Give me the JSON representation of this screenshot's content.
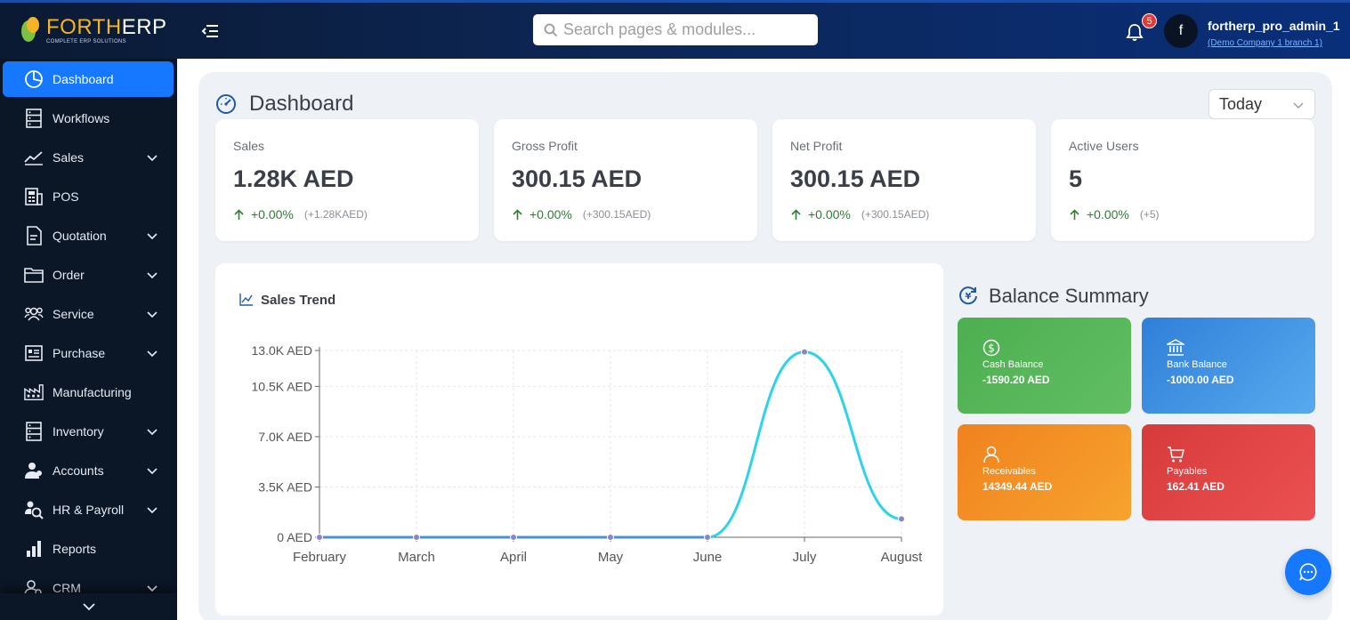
{
  "brand": {
    "name_part1": "FORTH",
    "name_part2": "ERP",
    "tagline": "COMPLETE ERP SOLUTIONS"
  },
  "header": {
    "search_placeholder": "Search pages & modules...",
    "notifications_count": "5",
    "avatar_letter": "f",
    "user_name": "fortherp_pro_admin_1",
    "company": "(Demo Company 1 branch 1)"
  },
  "sidebar": {
    "items": [
      {
        "label": "Dashboard",
        "icon": "pie-chart-icon",
        "active": true,
        "expandable": false
      },
      {
        "label": "Workflows",
        "icon": "workflow-icon",
        "expandable": false
      },
      {
        "label": "Sales",
        "icon": "line-chart-icon",
        "expandable": true
      },
      {
        "label": "POS",
        "icon": "calculator-icon",
        "expandable": false
      },
      {
        "label": "Quotation",
        "icon": "document-icon",
        "expandable": true
      },
      {
        "label": "Order",
        "icon": "folder-icon",
        "expandable": true
      },
      {
        "label": "Service",
        "icon": "team-icon",
        "expandable": true
      },
      {
        "label": "Purchase",
        "icon": "id-card-icon",
        "expandable": true
      },
      {
        "label": "Manufacturing",
        "icon": "factory-icon",
        "expandable": false
      },
      {
        "label": "Inventory",
        "icon": "inventory-icon",
        "expandable": true
      },
      {
        "label": "Accounts",
        "icon": "user-group-icon",
        "expandable": true
      },
      {
        "label": "HR & Payroll",
        "icon": "hr-icon",
        "expandable": true
      },
      {
        "label": "Reports",
        "icon": "bar-chart-icon",
        "expandable": false
      },
      {
        "label": "CRM",
        "icon": "crm-icon",
        "expandable": true
      }
    ]
  },
  "dashboard": {
    "title": "Dashboard",
    "range": "Today",
    "stats": [
      {
        "title": "Sales",
        "value": "1.28K AED",
        "delta": "+0.00%",
        "note": "(+1.28KAED)"
      },
      {
        "title": "Gross Profit",
        "value": "300.15 AED",
        "delta": "+0.00%",
        "note": "(+300.15AED)"
      },
      {
        "title": "Net Profit",
        "value": "300.15 AED",
        "delta": "+0.00%",
        "note": "(+300.15AED)"
      },
      {
        "title": "Active Users",
        "value": "5",
        "delta": "+0.00%",
        "note": "(+5)"
      }
    ],
    "balance_title": "Balance Summary",
    "balances": [
      {
        "title": "Cash Balance",
        "value": "-1590.20 AED",
        "icon": "dollar-icon",
        "color": "#4caf50"
      },
      {
        "title": "Bank Balance",
        "value": "-1000.00 AED",
        "icon": "bank-icon",
        "color": "#2f7fd9"
      },
      {
        "title": "Receivables",
        "value": "14349.44 AED",
        "icon": "user-icon",
        "color": "#f0821e"
      },
      {
        "title": "Payables",
        "value": "162.41 AED",
        "icon": "cart-icon",
        "color": "#d73a3a"
      }
    ]
  },
  "chart_data": {
    "type": "line",
    "title": "Sales Trend",
    "categories": [
      "February",
      "March",
      "April",
      "May",
      "June",
      "July",
      "August"
    ],
    "values": [
      0,
      0,
      0,
      0,
      0,
      12900,
      1280
    ],
    "yticks": [
      0,
      3500,
      7000,
      10500,
      13000
    ],
    "ytick_labels": [
      "0 AED",
      "3.5K AED",
      "7.0K AED",
      "10.5K AED",
      "13.0K AED"
    ],
    "ylim": [
      0,
      13000
    ],
    "grid": true,
    "line_color": "#2bd4e6",
    "baseline_color": "#4a90d9"
  }
}
